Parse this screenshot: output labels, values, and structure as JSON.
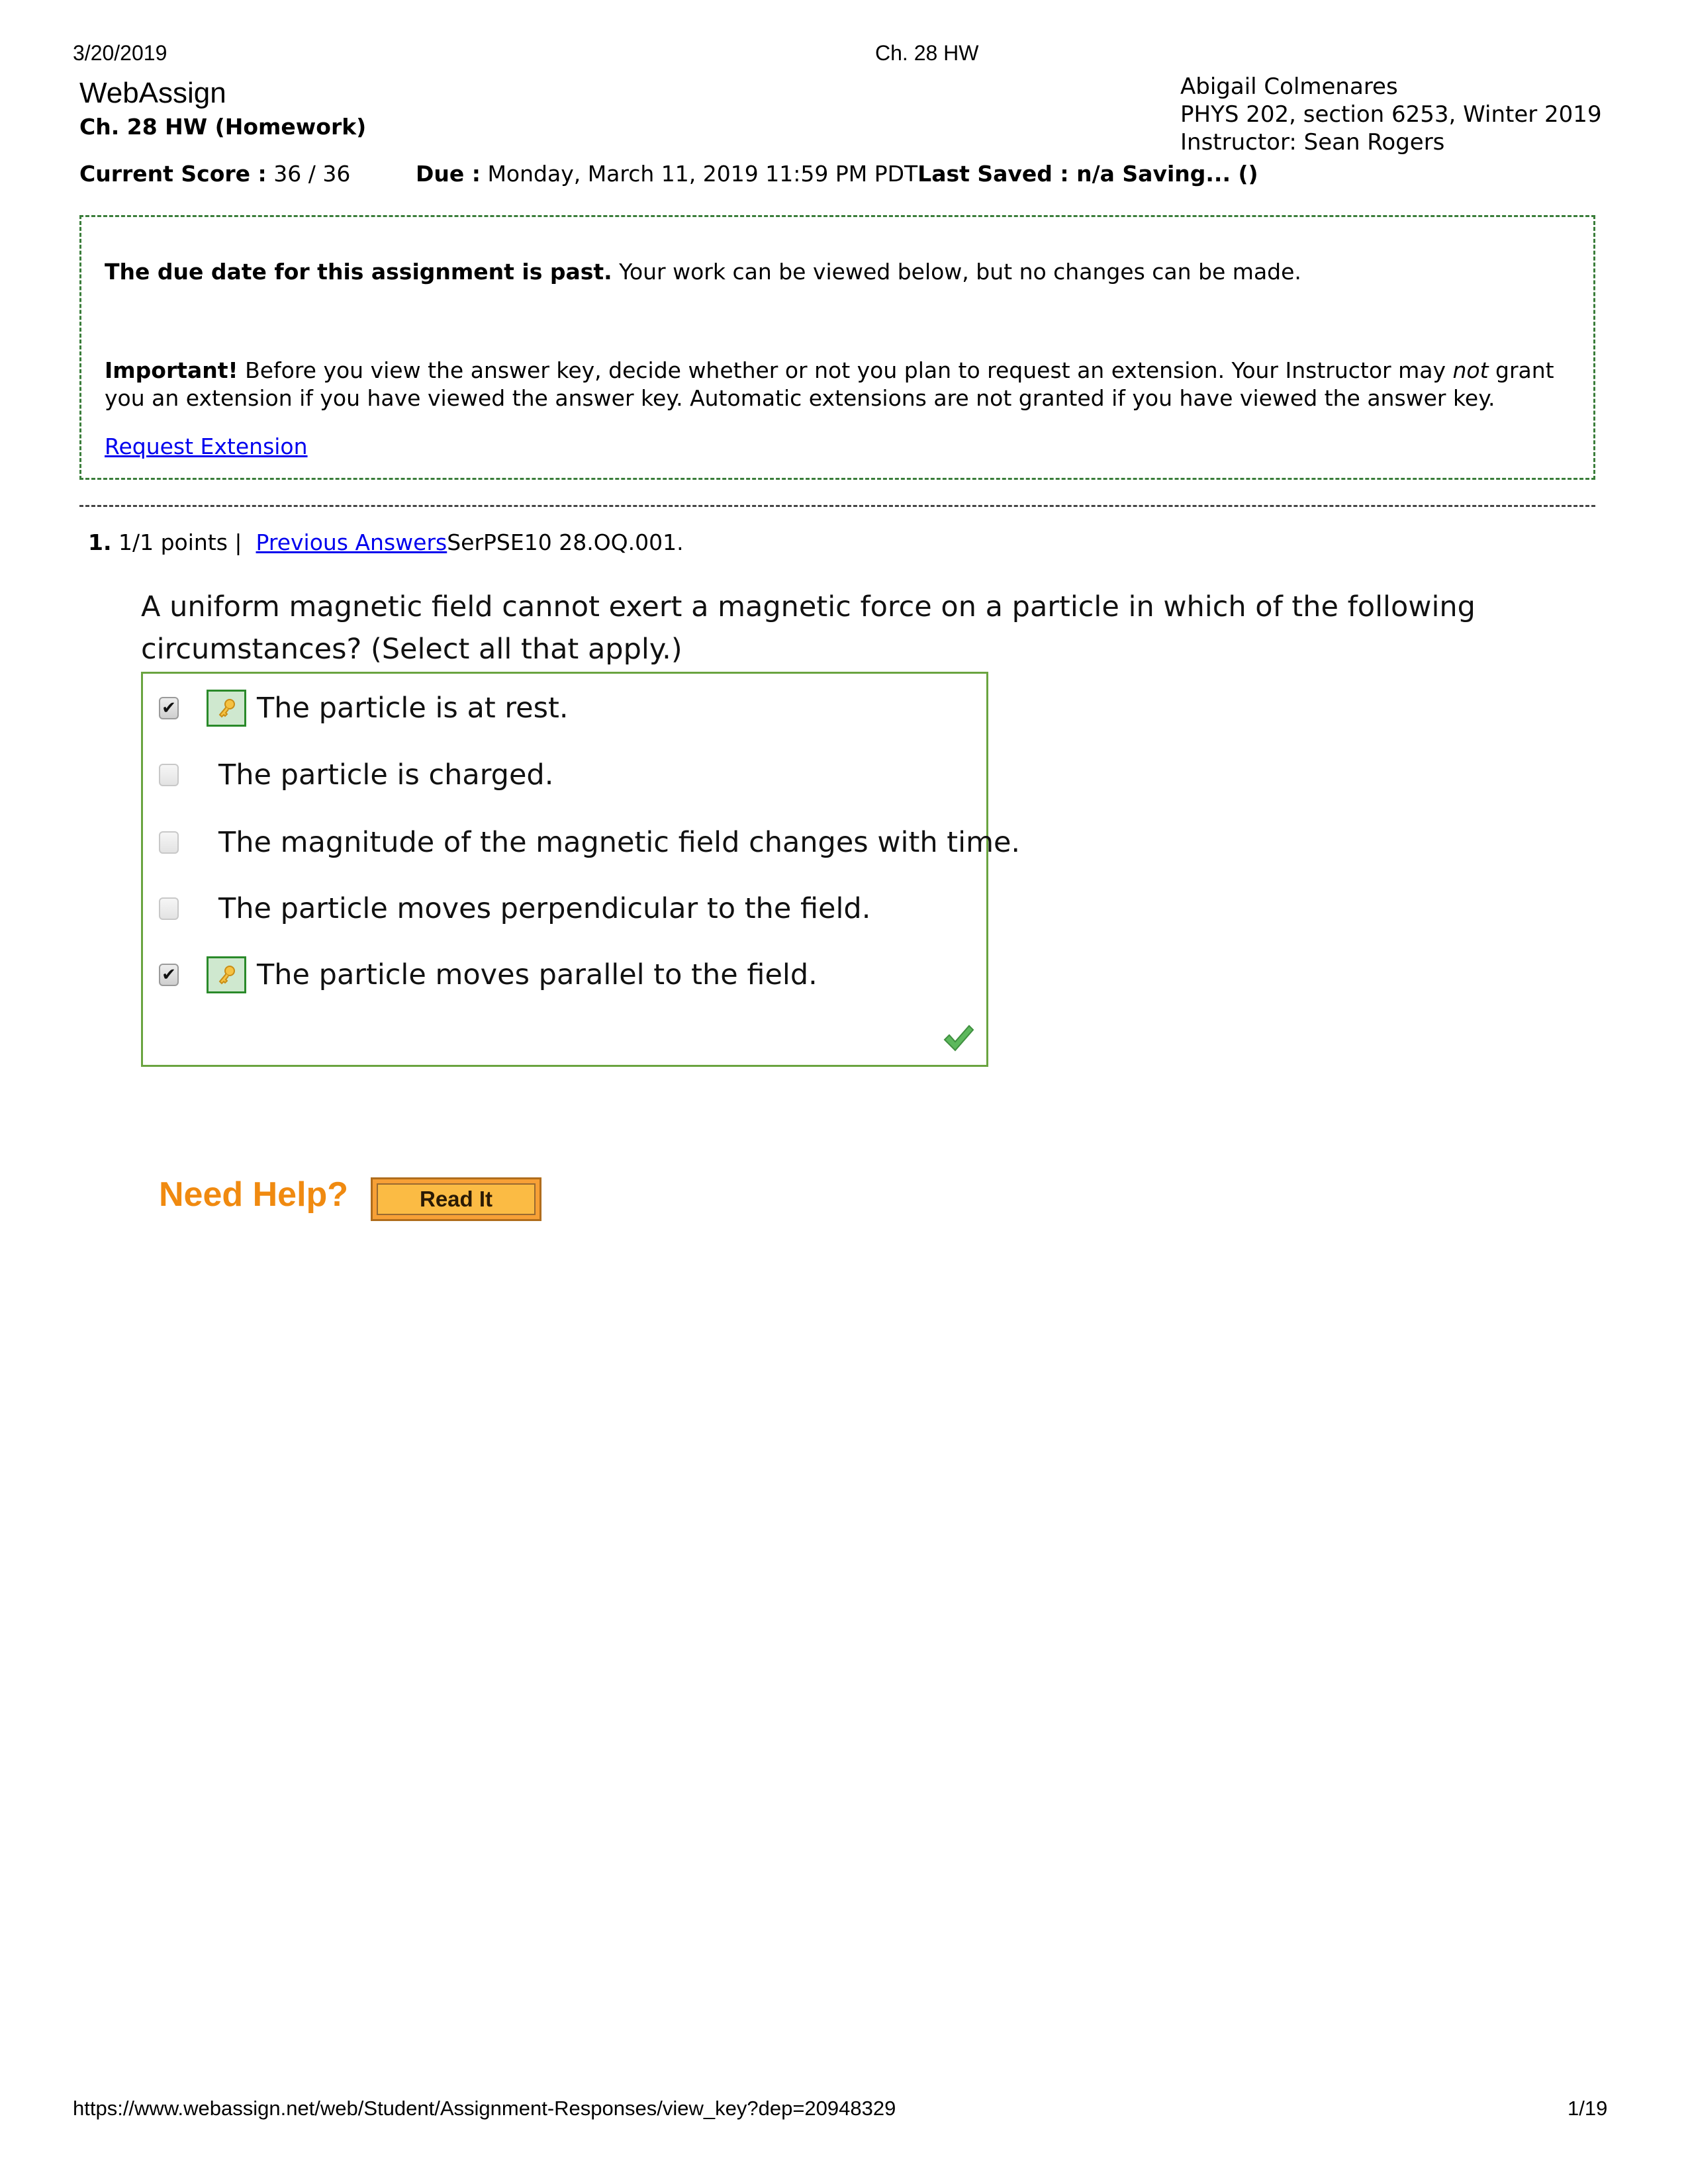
{
  "print_header": {
    "date": "3/20/2019",
    "title": "Ch. 28 HW"
  },
  "app": {
    "brand": "WebAssign",
    "assignment_title": "Ch. 28 HW (Homework)"
  },
  "user_info": {
    "name": "Abigail Colmenares",
    "course": "PHYS 202, section 6253, Winter 2019",
    "instructor": "Instructor: Sean Rogers"
  },
  "status_bar": {
    "score_label": "Current Score :",
    "score_value": "36 / 36",
    "due_label": "Due :",
    "due_value": "Monday, March 11, 2019 11:59 PM PDT",
    "last_saved": "Last Saved : n/a Saving...  ()"
  },
  "notice": {
    "past_due_bold": "The due date for this assignment is past.",
    "past_due_text": " Your work can be viewed below, but no changes can be made.",
    "important_bold": "Important!",
    "important_text_1": " Before you view the answer key, decide whether or not you plan to request an extension. Your Instructor may ",
    "important_em": "not",
    "important_text_2": " grant you an extension if you have viewed the answer key. Automatic extensions are not granted if you have viewed the answer key.",
    "request_extension_link": "Request Extension"
  },
  "question": {
    "number": "1.",
    "points": " 1/1 points |  ",
    "previous_answers_link": "Previous Answers",
    "code": "SerPSE10 28.OQ.001.",
    "text": "A uniform magnetic field cannot exert a magnetic force on a particle in which of the following circumstances? (Select all that apply.)",
    "options": [
      {
        "label": "The particle is at rest.",
        "checked": true,
        "key_icon": true
      },
      {
        "label": "The particle is charged.",
        "checked": false,
        "key_icon": false
      },
      {
        "label": "The magnitude of the magnetic field changes with time.",
        "checked": false,
        "key_icon": false
      },
      {
        "label": "The particle moves perpendicular to the field.",
        "checked": false,
        "key_icon": false
      },
      {
        "label": "The particle moves parallel to the field.",
        "checked": true,
        "key_icon": true
      }
    ],
    "result_icon": "correct-checkmark-icon"
  },
  "help": {
    "need_help": "Need Help?",
    "read_it_button": "Read It"
  },
  "footer": {
    "url": "https://www.webassign.net/web/Student/Assignment-Responses/view_key?dep=20948329",
    "page": "1/19"
  },
  "colors": {
    "notice_border": "#3a7d3a",
    "answer_box_border": "#6aa440",
    "link": "#0000ee",
    "need_help": "#f08a10",
    "read_it_bg": "#fbbb44",
    "correct_check": "#5cb85c"
  }
}
